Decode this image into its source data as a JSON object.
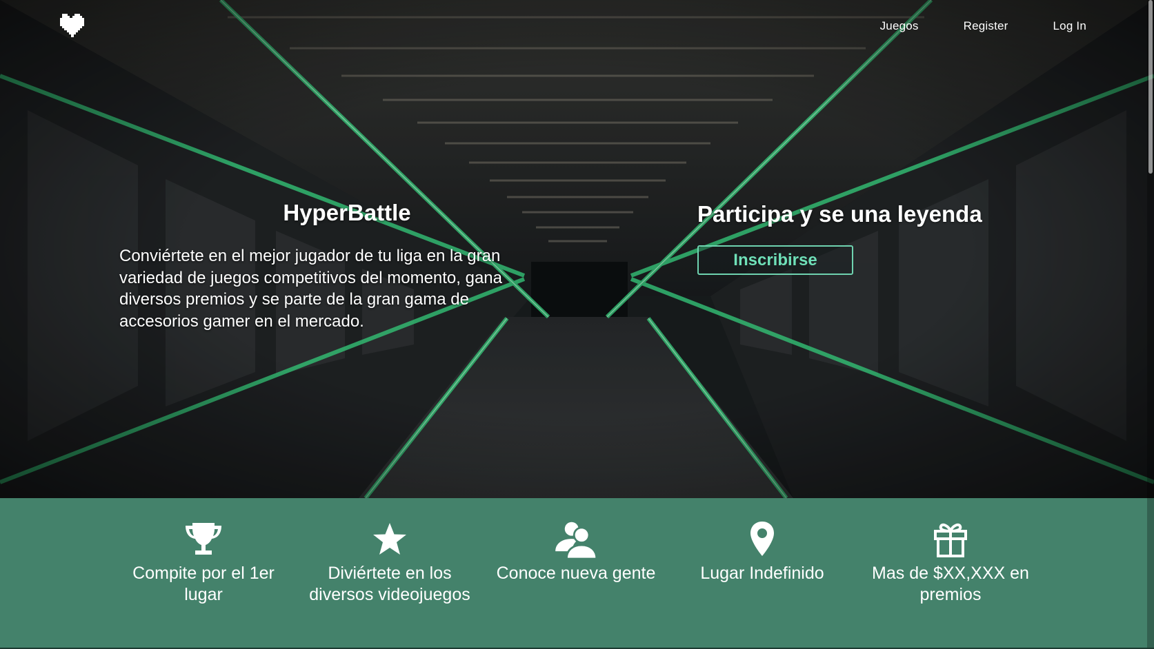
{
  "brand": {
    "logo_icon": "heart-icon"
  },
  "nav": {
    "items": [
      {
        "label": "Juegos"
      },
      {
        "label": "Register"
      },
      {
        "label": "Log In"
      }
    ]
  },
  "hero": {
    "title": "HyperBattle",
    "description": "Conviértete en el mejor jugador de tu liga en la gran variedad de juegos competitivos del momento, gana diversos premios y se parte de la gran gama de accesorios gamer en el mercado.",
    "subtitle": "Participa y se una leyenda",
    "cta_label": "Inscribirse",
    "background": "sci-fi tunnel with green neon lines"
  },
  "features": {
    "items": [
      {
        "icon": "trophy-icon",
        "label": "Compite por el 1er lugar"
      },
      {
        "icon": "star-icon",
        "label": "Diviértete en los diversos videojuegos"
      },
      {
        "icon": "users-icon",
        "label": "Conoce nueva gente"
      },
      {
        "icon": "map-pin-icon",
        "label": "Lugar Indefinido"
      },
      {
        "icon": "gift-icon",
        "label": "Mas de $XX,XXX en premios"
      }
    ]
  },
  "colors": {
    "accent": "#6fe0b8",
    "features_bg": "#44826b",
    "neon": "#3ee08a"
  }
}
